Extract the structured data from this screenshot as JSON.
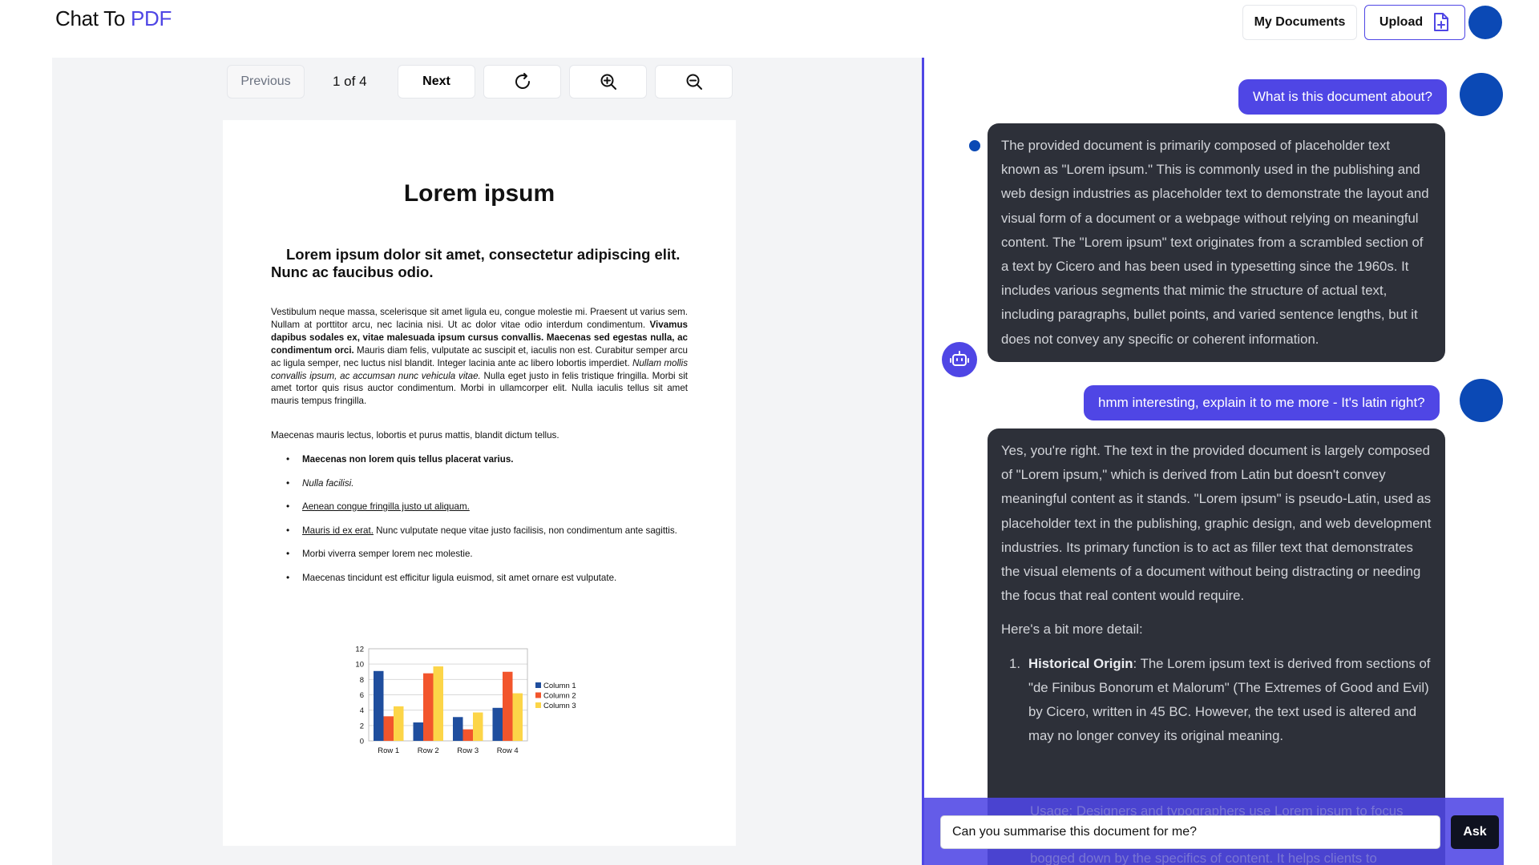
{
  "header": {
    "logo_text": "Chat To",
    "logo_accent": "PDF",
    "my_documents_label": "My Documents",
    "upload_label": "Upload"
  },
  "viewer": {
    "prev_label": "Previous",
    "page_indicator": "1 of 4",
    "next_label": "Next"
  },
  "document": {
    "title": "Lorem ipsum",
    "subtitle": "Lorem ipsum dolor sit amet, consectetur adipiscing elit. Nunc ac faucibus odio.",
    "para1_a": "Vestibulum neque massa, scelerisque sit amet ligula eu, congue molestie mi. Praesent ut varius sem. Nullam at porttitor arcu, nec lacinia nisi. Ut ac dolor vitae odio interdum condimentum. ",
    "para1_b": "Vivamus dapibus sodales ex, vitae malesuada ipsum cursus convallis. Maecenas sed egestas nulla, ac condimentum orci.",
    "para1_c": " Mauris diam felis, vulputate ac suscipit et, iaculis non est. Curabitur semper arcu ac ligula semper, nec luctus nisl blandit. Integer lacinia ante ac libero lobortis imperdiet. ",
    "para1_d": "Nullam mollis convallis ipsum, ac accumsan nunc vehicula vitae.",
    "para1_e": " Nulla eget justo in felis tristique fringilla. Morbi sit amet tortor quis risus auctor condimentum. Morbi in ullamcorper elit. Nulla iaculis tellus sit amet mauris tempus fringilla.",
    "para2": "Maecenas mauris lectus, lobortis et purus mattis, blandit dictum tellus.",
    "list": [
      "Maecenas non lorem quis tellus placerat varius.",
      "Nulla facilisi.",
      "Aenean congue fringilla justo ut aliquam.",
      "Mauris id ex erat.",
      " Nunc vulputate neque vitae justo facilisis, non condimentum ante sagittis.",
      "Morbi viverra semper lorem nec molestie.",
      "Maecenas tincidunt est efficitur ligula euismod, sit amet ornare est vulputate."
    ]
  },
  "chart_data": {
    "type": "bar",
    "categories": [
      "Row 1",
      "Row 2",
      "Row 3",
      "Row 4"
    ],
    "series": [
      {
        "name": "Column 1",
        "values": [
          9.1,
          2.4,
          3.1,
          4.3
        ],
        "color": "#1f4e9e"
      },
      {
        "name": "Column 2",
        "values": [
          3.2,
          8.8,
          1.5,
          9.0
        ],
        "color": "#f2552c"
      },
      {
        "name": "Column 3",
        "values": [
          4.5,
          9.7,
          3.7,
          6.2
        ],
        "color": "#fcd548"
      }
    ],
    "ylim": [
      0,
      12
    ],
    "yticks": [
      "0",
      "2",
      "4",
      "6",
      "8",
      "10",
      "12"
    ],
    "legend": "right",
    "grid": true
  },
  "chat": {
    "user1": "What is this document about?",
    "bot1": "The provided document is primarily composed of placeholder text known as \"Lorem ipsum.\" This is commonly used in the publishing and web design industries as placeholder text to demonstrate the layout and visual form of a document or a webpage without relying on meaningful content. The \"Lorem ipsum\" text originates from a scrambled section of a text by Cicero and has been used in typesetting since the 1960s. It includes various segments that mimic the structure of actual text, including paragraphs, bullet points, and varied sentence lengths, but it does not convey any specific or coherent information.",
    "user2": "hmm interesting, explain it to me more - It's latin right?",
    "bot2_p1": "Yes, you're right. The text in the provided document is largely composed of \"Lorem ipsum,\" which is derived from Latin but doesn't convey meaningful content as it stands. \"Lorem ipsum\" is pseudo-Latin, used as placeholder text in the publishing, graphic design, and web development industries. Its primary function is to act as filler text that demonstrates the visual elements of a document without being distracting or needing the focus that real content would require.",
    "bot2_p2": "Here's a bit more detail:",
    "bot2_item1_num": "1.",
    "bot2_item1_title": "Historical Origin",
    "bot2_item1_text": ": The Lorem ipsum text is derived from sections of \"de Finibus Bonorum et Malorum\" (The Extremes of Good and Evil) by Cicero, written in 45 BC. However, the text used is altered and may no longer convey its original meaning.",
    "bot2_hidden1": "Usage: Designers and typographers use Lorem ipsum to focus",
    "bot2_hidden2": "bogged down by the specifics of content. It helps clients to",
    "input_value": "Can you summarise this document for me?",
    "ask_label": "Ask"
  }
}
